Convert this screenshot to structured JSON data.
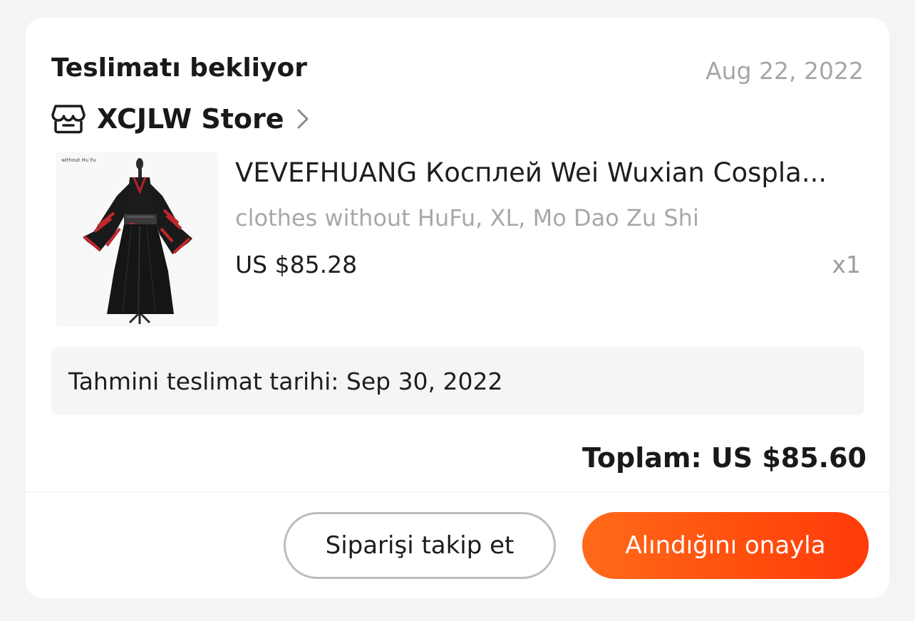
{
  "order": {
    "status": "Teslimatı bekliyor",
    "date": "Aug 22, 2022"
  },
  "store": {
    "icon": "store-icon",
    "name": "XCJLW Store",
    "chevron_icon": "chevron-right-icon"
  },
  "product": {
    "image_label": "without Hu Fu",
    "name": "VEVEFHUANG Косплей Wei Wuxian Cospla...",
    "variant": "clothes without HuFu, XL, Mo Dao Zu Shi",
    "price": "US $85.28",
    "quantity": "x1"
  },
  "delivery": {
    "estimate": "Tahmini teslimat tarihi: Sep 30, 2022"
  },
  "total": {
    "text": "Toplam: US $85.60"
  },
  "actions": {
    "track_label": "Siparişi takip et",
    "confirm_label": "Alındığını onayla"
  },
  "colors": {
    "page_background": "#f4f4f4",
    "card_background": "#ffffff",
    "accent": "#ff4d0d",
    "muted_text": "#a6a6a6"
  }
}
